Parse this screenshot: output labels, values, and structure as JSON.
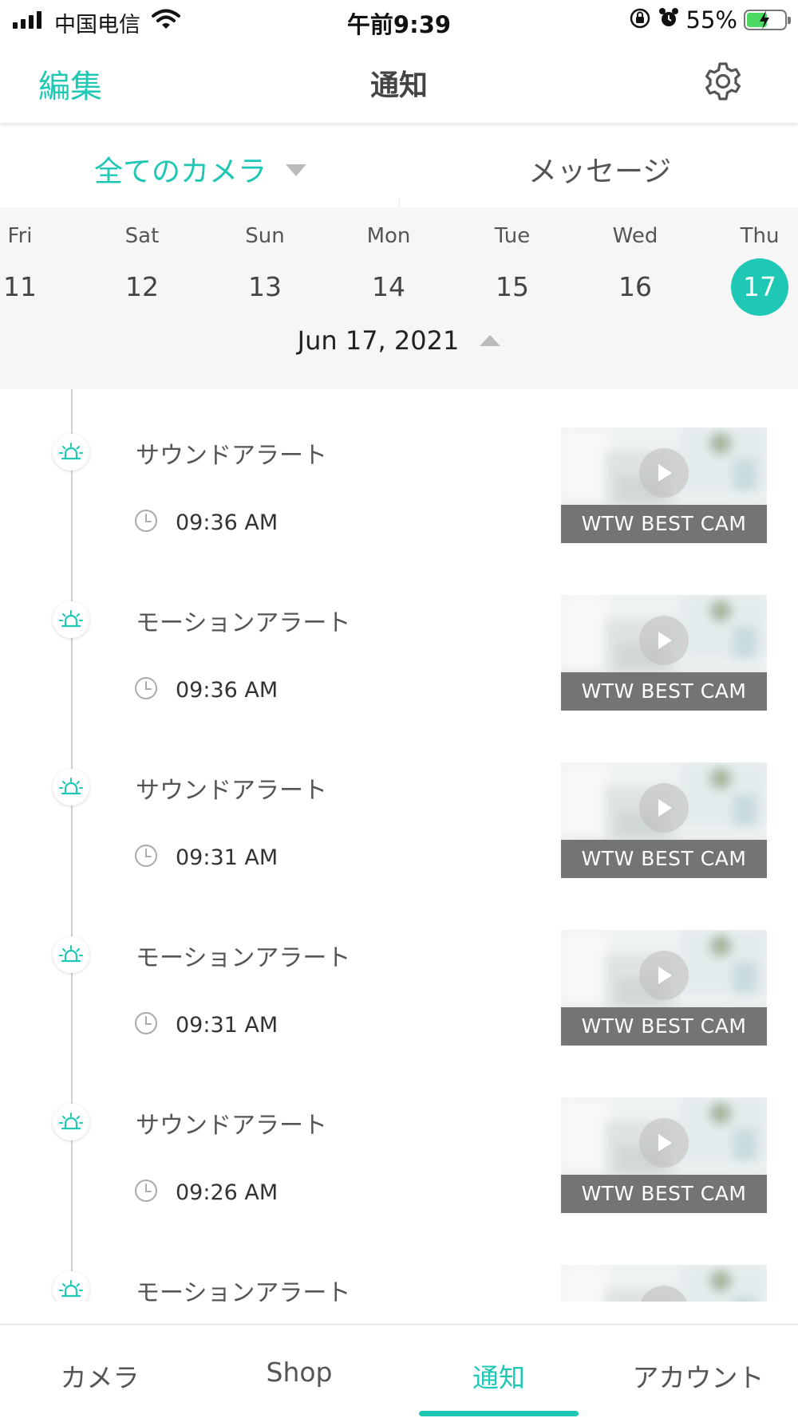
{
  "status_bar": {
    "carrier": "中国电信",
    "time": "午前9:39",
    "battery": "55%",
    "battery_level": 0.55
  },
  "header": {
    "edit_label": "編集",
    "title": "通知",
    "settings_icon": "gear-icon"
  },
  "filter": {
    "camera_select": "全てのカメラ",
    "messages_label": "メッセージ"
  },
  "calendar": {
    "days": [
      {
        "name": "Fri",
        "num": "11"
      },
      {
        "name": "Sat",
        "num": "12"
      },
      {
        "name": "Sun",
        "num": "13"
      },
      {
        "name": "Mon",
        "num": "14"
      },
      {
        "name": "Tue",
        "num": "15"
      },
      {
        "name": "Wed",
        "num": "16"
      },
      {
        "name": "Thu",
        "num": "17",
        "selected": true
      }
    ],
    "selected_date": "Jun 17, 2021"
  },
  "events": [
    {
      "title": "サウンドアラート",
      "time": "09:36 AM",
      "camera": "WTW BEST CAM"
    },
    {
      "title": "モーションアラート",
      "time": "09:36 AM",
      "camera": "WTW BEST CAM"
    },
    {
      "title": "サウンドアラート",
      "time": "09:31 AM",
      "camera": "WTW BEST CAM"
    },
    {
      "title": "モーションアラート",
      "time": "09:31 AM",
      "camera": "WTW BEST CAM"
    },
    {
      "title": "サウンドアラート",
      "time": "09:26 AM",
      "camera": "WTW BEST CAM"
    },
    {
      "title": "モーションアラート",
      "time": "",
      "camera": ""
    }
  ],
  "tabbar": {
    "tabs": [
      {
        "label": "カメラ"
      },
      {
        "label": "Shop"
      },
      {
        "label": "通知",
        "active": true
      },
      {
        "label": "アカウント"
      }
    ]
  },
  "colors": {
    "accent": "#1ec8b4",
    "date_strip_bg": "#f6f6f6",
    "thumb_label_bg": "#5a5a5a"
  }
}
